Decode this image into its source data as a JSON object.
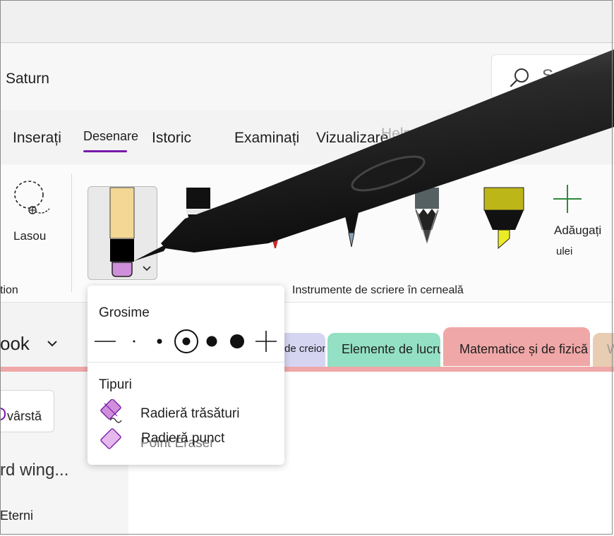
{
  "window": {
    "app_title": "Saturn",
    "search_placeholder": "Search"
  },
  "tabs": [
    {
      "label": "Inserați"
    },
    {
      "label": "Desenare"
    },
    {
      "label": "Istoric"
    },
    {
      "label": "Examinați"
    },
    {
      "label": "Vizualizare"
    },
    {
      "label": "Help"
    }
  ],
  "ribbon": {
    "lasso_label": "Lasou",
    "left_group_label_fragment": "tion",
    "add_label": "Adăugați",
    "add_label_line2": "ulei",
    "group_label": "Instrumente de scriere în cerneală",
    "pen_colors": {
      "selected_top": "#f4d795",
      "eraser_tip": "#d08fda",
      "highlighter": "#bdb619",
      "highlighter_tip": "#ecec26",
      "accent": "#2e8b3a"
    }
  },
  "eraser_panel": {
    "thickness_title": "Grosime",
    "types_title": "Tipuri",
    "types": [
      {
        "label": "Radieră trăsături",
        "icon": "stroke-eraser-icon"
      },
      {
        "label": "Radieră punct",
        "icon": "point-eraser-icon",
        "ghost_text": "Point Eraser"
      }
    ]
  },
  "notebook": {
    "name_fragment": "ook",
    "sections": [
      {
        "label": "de creion",
        "color": "#d5d5f2"
      },
      {
        "label": "Elemente de lucru",
        "color": "#94e0c4"
      },
      {
        "label": "Matematice și de fizică",
        "color": "#f0a7a7"
      },
      {
        "label": "W",
        "color": "#e8cdb2"
      }
    ],
    "age_button": "vârstă",
    "pages": [
      {
        "label": "rd wing..."
      },
      {
        "label": "Eterni"
      }
    ]
  }
}
